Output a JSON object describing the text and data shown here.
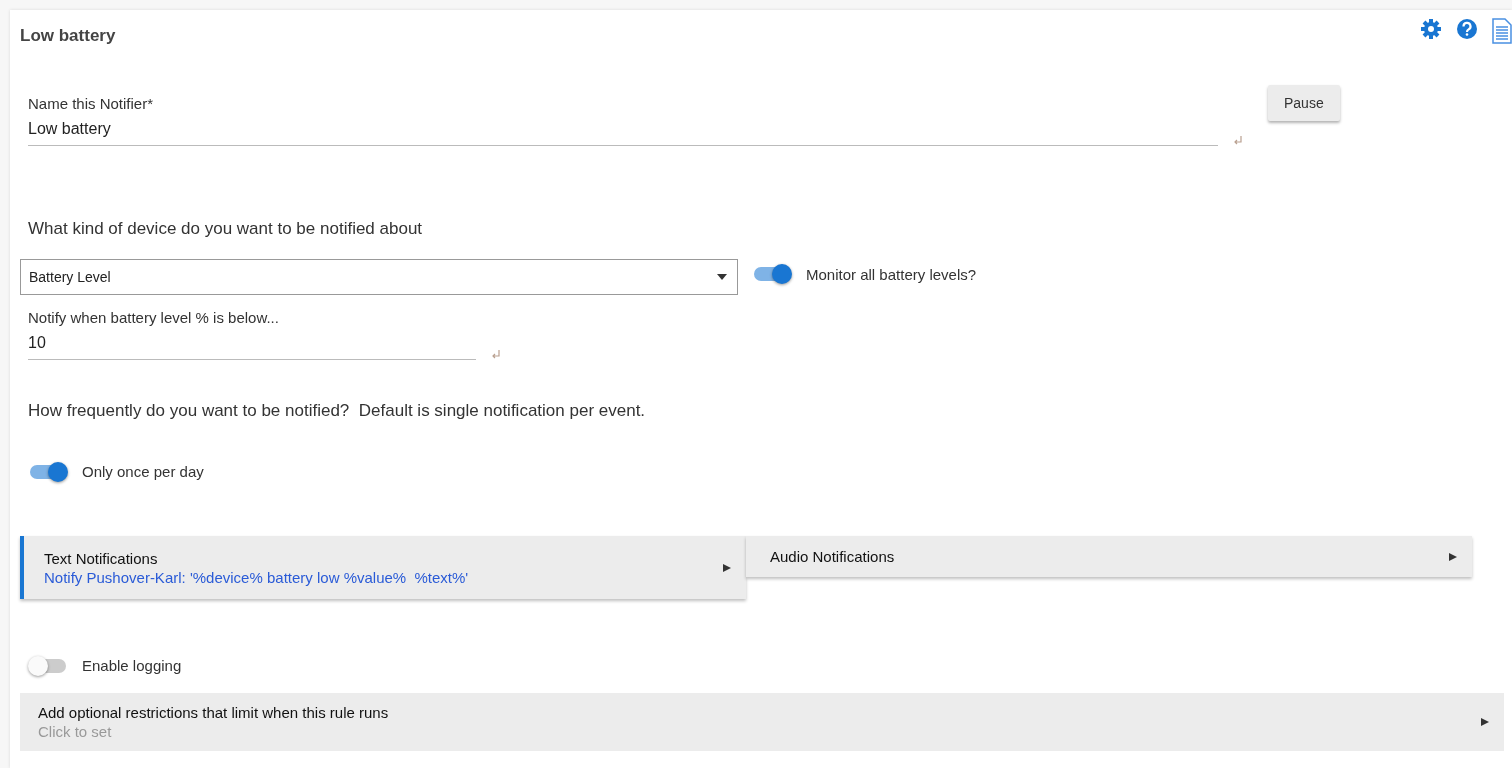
{
  "page": {
    "title": "Low battery"
  },
  "name_field": {
    "label": "Name this Notifier*",
    "value": "Low battery"
  },
  "pause_button": {
    "label": "Pause"
  },
  "device_question": "What kind of device do you want to be notified about",
  "device_select": {
    "value": "Battery Level"
  },
  "monitor_all": {
    "label": "Monitor all battery levels?",
    "on": true
  },
  "threshold_field": {
    "label": "Notify when battery level % is below...",
    "value": "10"
  },
  "frequency_question": "How frequently do you want to be notified?  Default is single notification per event.",
  "once_per_day": {
    "label": "Only once per day",
    "on": true
  },
  "sections": [
    {
      "title": "Text Notifications",
      "summary": "Notify Pushover-Karl: '%device% battery low %value%  %text%'",
      "configured": true
    },
    {
      "title": "Audio Notifications",
      "configured": false
    }
  ],
  "logging": {
    "label": "Enable logging",
    "on": false
  },
  "restrictions": {
    "title": "Add optional restrictions that limit when this rule runs",
    "hint": "Click to set"
  }
}
